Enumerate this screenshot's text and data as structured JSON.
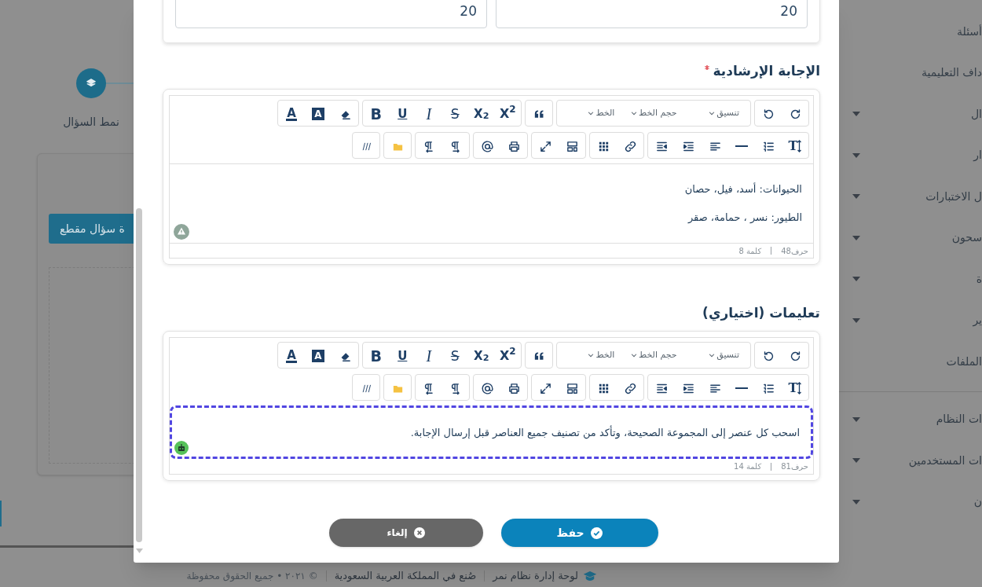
{
  "background": {
    "step": {
      "label": "نمط السؤال"
    },
    "action_button": "ة سؤال مقطع",
    "sidebar": [
      [
        {
          "label": "أسئلة",
          "has_caret": false
        },
        {
          "label": "داف التعليمية",
          "has_caret": false
        },
        {
          "label": "ال",
          "has_caret": true
        },
        {
          "label": "ار",
          "has_caret": true
        },
        {
          "label": "ل الاختبارات",
          "has_caret": true
        },
        {
          "label": "سحون",
          "has_caret": true
        },
        {
          "label": "ة",
          "has_caret": true
        },
        {
          "label": "ير",
          "has_caret": true
        },
        {
          "label": "الملفات",
          "has_caret": false
        }
      ],
      [
        {
          "label": "ات النظام",
          "has_caret": true
        },
        {
          "label": "ات المستخدمين",
          "has_caret": true
        },
        {
          "label": "ن",
          "has_caret": true
        }
      ]
    ],
    "footer": {
      "brand": "لوحة إدارة نظام نمر",
      "made_in": "صُنع في المملكة العربية السعودية",
      "copyright": "© ٢٠٢١ • جميع الحقوق محفوظة"
    }
  },
  "modal": {
    "top_inputs": [
      "20",
      "20"
    ],
    "editors": [
      {
        "label": "الإجابة الإرشادية",
        "required": true,
        "focused": false,
        "badge": {
          "kind": "warning"
        },
        "toolbar": {
          "dropdowns": [
            "تنسيق",
            "حجم الخط",
            "الخط"
          ],
          "text_buttons": [
            {
              "kind": "superscript",
              "label": "X$^{2}$"
            },
            {
              "kind": "subscript",
              "label": "X$_{2}$"
            },
            {
              "kind": "strike",
              "label": "S"
            },
            {
              "kind": "italic",
              "label": "I"
            },
            {
              "kind": "underline",
              "label": "U"
            },
            {
              "kind": "bold",
              "label": "B"
            }
          ],
          "color_buttons": [
            {
              "kind": "background",
              "label": "A"
            },
            {
              "kind": "text",
              "label": "A"
            }
          ],
          "size_button": "T"
        },
        "lines": [
          "الحيوانات: أسد، فيل، حصان",
          "الطيور: نسر ، حمامة، صقر"
        ],
        "chars": "حرف48",
        "words": "كلمة 8"
      },
      {
        "label": "تعليمات (اختياري)",
        "required": false,
        "focused": true,
        "badge": {
          "kind": "bot"
        },
        "toolbar": {
          "dropdowns": [
            "تنسيق",
            "حجم الخط",
            "الخط"
          ],
          "text_buttons": [
            {
              "kind": "superscript",
              "label": "X$^{2}$"
            },
            {
              "kind": "subscript",
              "label": "X$_{2}$"
            },
            {
              "kind": "strike",
              "label": "S"
            },
            {
              "kind": "italic",
              "label": "I"
            },
            {
              "kind": "underline",
              "label": "U"
            },
            {
              "kind": "bold",
              "label": "B"
            }
          ],
          "color_buttons": [
            {
              "kind": "background",
              "label": "A"
            },
            {
              "kind": "text",
              "label": "A"
            }
          ],
          "size_button": "T"
        },
        "lines": [
          "اسحب كل عنصر إلى المجموعة الصحيحة، وتأكد من تصنيف جميع العناصر قبل إرسال الإجابة."
        ],
        "chars": "حرف81",
        "words": "كلمة 14"
      }
    ],
    "buttons": [
      {
        "kind": "save",
        "label": "حفظ"
      },
      {
        "kind": "cancel",
        "label": "إلغاء"
      }
    ]
  }
}
